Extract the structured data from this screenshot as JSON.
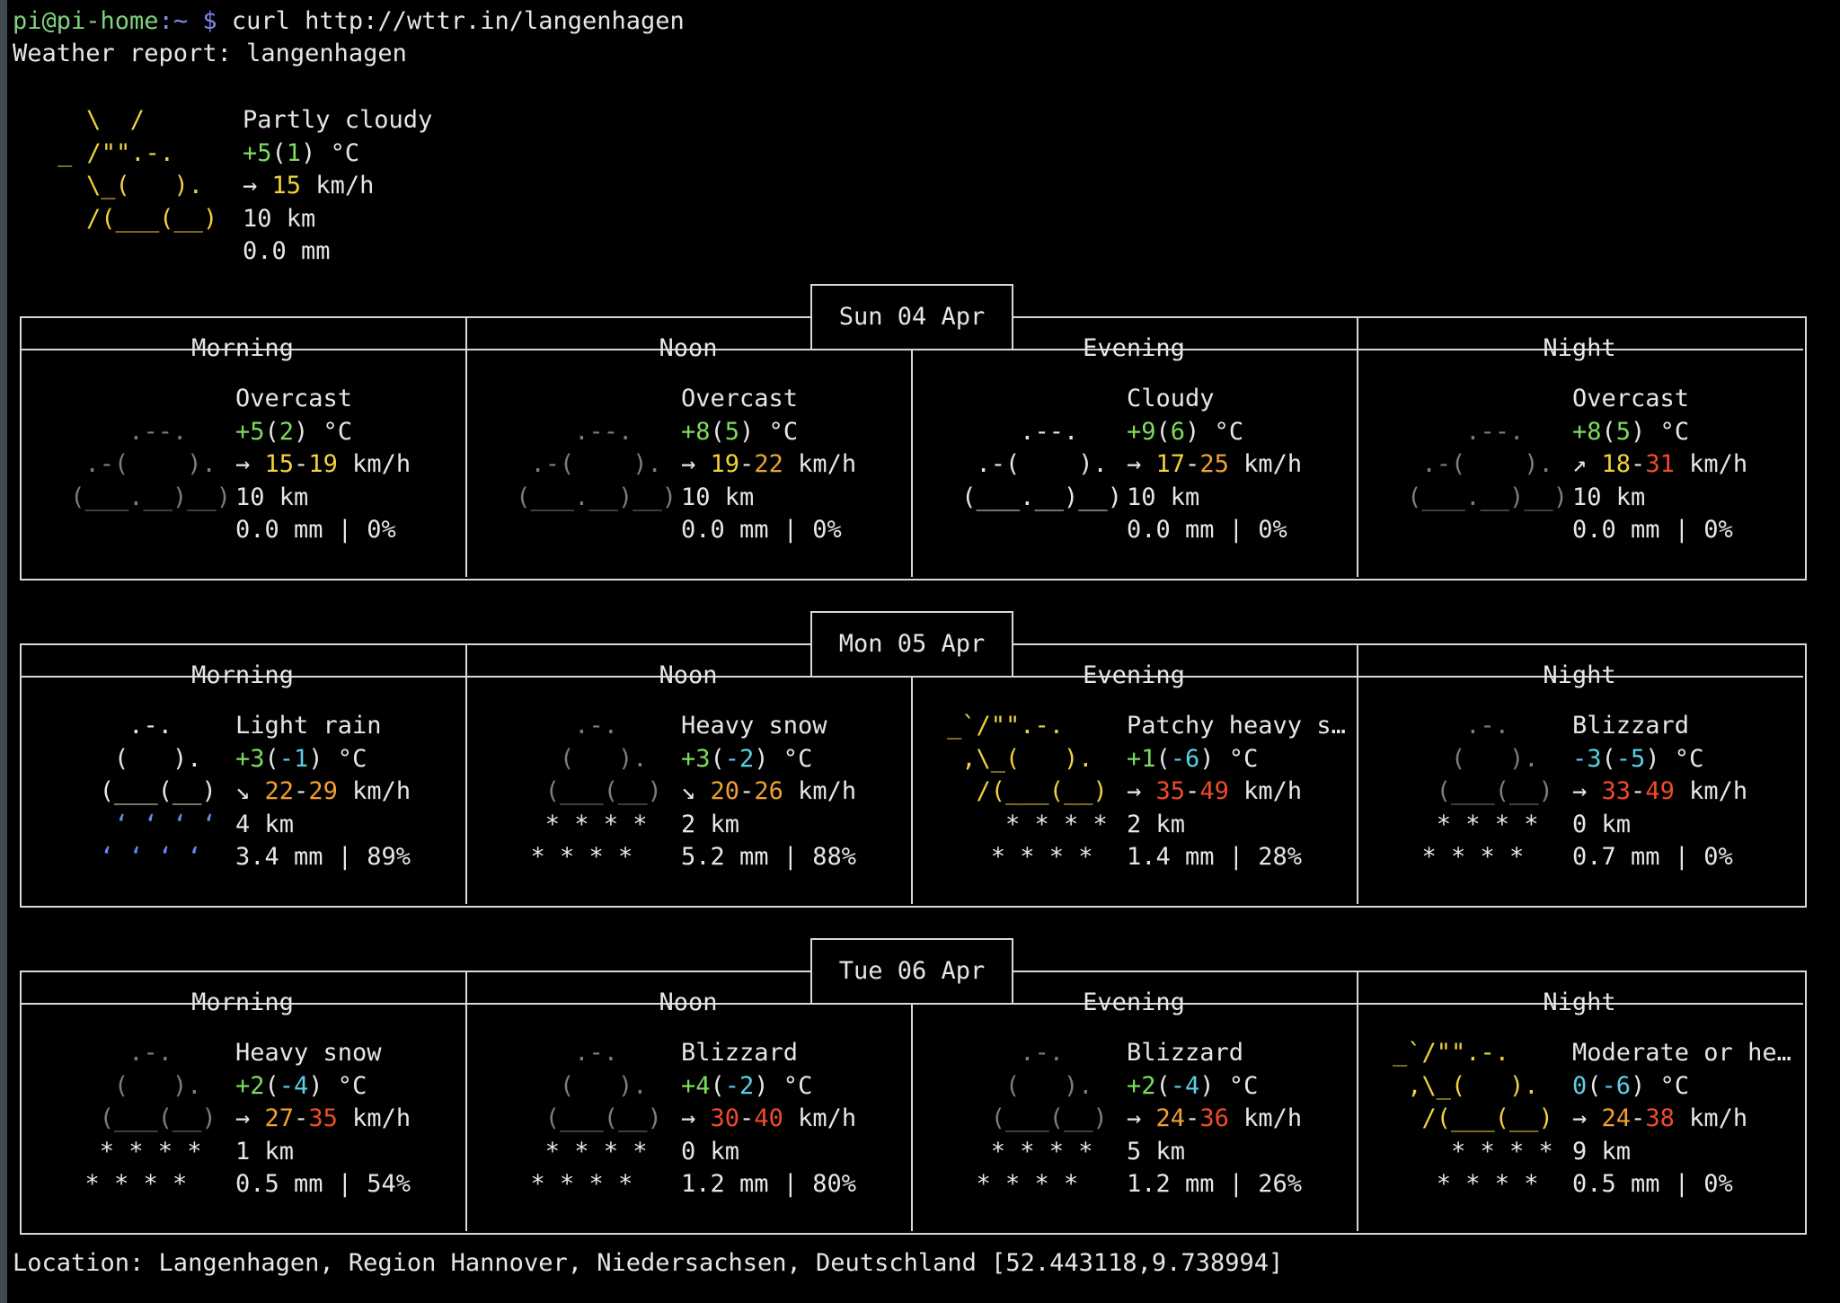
{
  "prompt": {
    "user": "pi@pi-home",
    "path": ":~",
    "symbol": "$",
    "command": "curl http://wttr.in/langenhagen"
  },
  "report_title": "Weather report: langenhagen",
  "current": {
    "art": [
      "\\  /",
      "_ /\"\".-.",
      "\\_(   ).",
      "/(___(__)"
    ],
    "condition": "Partly cloudy",
    "temp": "+5",
    "feels": "1",
    "unit": "°C",
    "wind_dir": "→",
    "wind": "15",
    "wind_unit": "km/h",
    "visibility": "10 km",
    "precip": "0.0 mm"
  },
  "days": [
    {
      "date": "Sun 04 Apr",
      "periods": [
        {
          "label": "Morning",
          "condition": "Overcast",
          "temp": "+5",
          "feels": "2",
          "wind_dir": "→",
          "wind_lo": "15",
          "wind_hi": "19",
          "vis": "10 km",
          "rain": "0.0 mm | 0%",
          "art_type": "overcast"
        },
        {
          "label": "Noon",
          "condition": "Overcast",
          "temp": "+8",
          "feels": "5",
          "wind_dir": "→",
          "wind_lo": "19",
          "wind_hi": "22",
          "vis": "10 km",
          "rain": "0.0 mm | 0%",
          "art_type": "overcast"
        },
        {
          "label": "Evening",
          "condition": "Cloudy",
          "temp": "+9",
          "feels": "6",
          "wind_dir": "→",
          "wind_lo": "17",
          "wind_hi": "25",
          "vis": "10 km",
          "rain": "0.0 mm | 0%",
          "art_type": "cloudy"
        },
        {
          "label": "Night",
          "condition": "Overcast",
          "temp": "+8",
          "feels": "5",
          "wind_dir": "↗",
          "wind_lo": "18",
          "wind_hi": "31",
          "vis": "10 km",
          "rain": "0.0 mm | 0%",
          "art_type": "overcast"
        }
      ]
    },
    {
      "date": "Mon 05 Apr",
      "periods": [
        {
          "label": "Morning",
          "condition": "Light rain",
          "temp": "+3",
          "feels": "-1",
          "wind_dir": "↘",
          "wind_lo": "22",
          "wind_hi": "29",
          "vis": "4 km",
          "rain": "3.4 mm | 89%",
          "art_type": "rain"
        },
        {
          "label": "Noon",
          "condition": "Heavy snow",
          "temp": "+3",
          "feels": "-2",
          "wind_dir": "↘",
          "wind_lo": "20",
          "wind_hi": "26",
          "vis": "2 km",
          "rain": "5.2 mm | 88%",
          "art_type": "snow"
        },
        {
          "label": "Evening",
          "condition": "Patchy heavy s…",
          "temp": "+1",
          "feels": "-6",
          "wind_dir": "→",
          "wind_lo": "35",
          "wind_hi": "49",
          "vis": "2 km",
          "rain": "1.4 mm | 28%",
          "art_type": "sunsnow"
        },
        {
          "label": "Night",
          "condition": "Blizzard",
          "temp": "-3",
          "feels": "-5",
          "wind_dir": "→",
          "wind_lo": "33",
          "wind_hi": "49",
          "vis": "0 km",
          "rain": "0.7 mm | 0%",
          "art_type": "snow"
        }
      ]
    },
    {
      "date": "Tue 06 Apr",
      "periods": [
        {
          "label": "Morning",
          "condition": "Heavy snow",
          "temp": "+2",
          "feels": "-4",
          "wind_dir": "→",
          "wind_lo": "27",
          "wind_hi": "35",
          "vis": "1 km",
          "rain": "0.5 mm | 54%",
          "art_type": "snow"
        },
        {
          "label": "Noon",
          "condition": "Blizzard",
          "temp": "+4",
          "feels": "-2",
          "wind_dir": "→",
          "wind_lo": "30",
          "wind_hi": "40",
          "vis": "0 km",
          "rain": "1.2 mm | 80%",
          "art_type": "snow"
        },
        {
          "label": "Evening",
          "condition": "Blizzard",
          "temp": "+2",
          "feels": "-4",
          "wind_dir": "→",
          "wind_lo": "24",
          "wind_hi": "36",
          "vis": "5 km",
          "rain": "1.2 mm | 26%",
          "art_type": "snow"
        },
        {
          "label": "Night",
          "condition": "Moderate or he…",
          "temp": "0",
          "feels": "-6",
          "wind_dir": "→",
          "wind_lo": "24",
          "wind_hi": "38",
          "vis": "9 km",
          "rain": "0.5 mm | 0%",
          "art_type": "sunsnow"
        }
      ]
    }
  ],
  "art": {
    "overcast": [
      "",
      "     .--.",
      "  .-(    ).",
      " (___.__)__)",
      ""
    ],
    "cloudy": [
      "",
      "     .--.",
      "  .-(    ).",
      " (___.__)__)",
      ""
    ],
    "rain": [
      "     .-.",
      "    (   ).",
      "   (___(__)",
      "    ʻ ʻ ʻ ʻ",
      "   ʻ ʻ ʻ ʻ"
    ],
    "snow": [
      "     .-.",
      "    (   ).",
      "   (___(__)",
      "   * * * *",
      "  * * * *"
    ],
    "sunsnow": [
      "_`/\"\".-.",
      " ,\\_(   ).",
      "  /(___(__)",
      "    * * * *",
      "   * * * *"
    ]
  },
  "location": "Location: Langenhagen, Region Hannover, Niedersachsen, Deutschland [52.443118,9.738994]",
  "colors": {
    "temp_mild": "#7edc5e",
    "temp_cold": "#5ad0e6",
    "wind_low": "#f0d23c",
    "wind_mid": "#f0a030",
    "wind_high": "#f04a2a"
  }
}
